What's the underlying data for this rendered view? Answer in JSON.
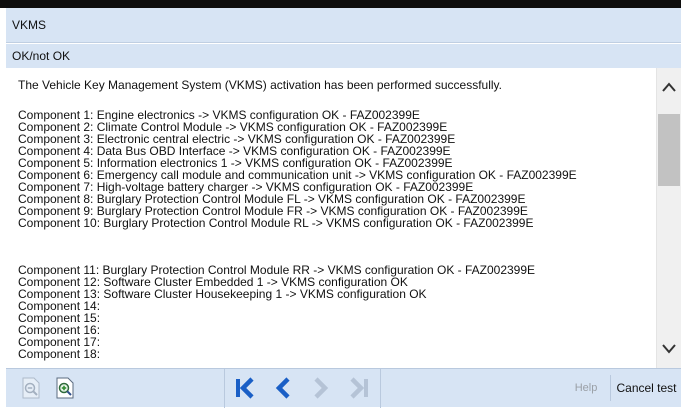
{
  "header": {
    "title": "VKMS",
    "status": "OK/not OK"
  },
  "content": {
    "message": "The Vehicle Key Management System (VKMS) activation has been performed successfully.",
    "group1": [
      "Component 1: Engine electronics -> VKMS configuration OK - FAZ002399E",
      "Component 2: Climate Control Module -> VKMS configuration OK - FAZ002399E",
      "Component 3: Electronic central electric -> VKMS configuration OK - FAZ002399E",
      "Component 4: Data Bus OBD Interface -> VKMS configuration OK - FAZ002399E",
      "Component 5: Information electronics 1 -> VKMS configuration OK - FAZ002399E",
      "Component 6: Emergency call module and communication unit -> VKMS configuration OK - FAZ002399E",
      "Component 7: High-voltage battery charger -> VKMS configuration OK - FAZ002399E",
      "Component 8: Burglary Protection Control Module FL -> VKMS configuration OK - FAZ002399E",
      "Component 9: Burglary Protection Control Module FR -> VKMS configuration OK - FAZ002399E",
      "Component 10: Burglary Protection Control Module RL -> VKMS configuration OK - FAZ002399E"
    ],
    "group2": [
      "Component 11: Burglary Protection Control Module RR -> VKMS configuration OK - FAZ002399E",
      "Component 12: Software Cluster Embedded 1 -> VKMS configuration OK",
      "Component 13: Software Cluster Housekeeping 1 -> VKMS configuration OK",
      "Component 14:",
      "Component 15:",
      "Component 16:",
      "Component 17:",
      "Component 18:"
    ]
  },
  "scrollbar": {
    "position": 0.1
  },
  "footer": {
    "icons": {
      "zoom_out": "zoom-out-icon",
      "zoom_in": "zoom-in-icon",
      "first": "skip-first-icon",
      "prev": "chevron-left-icon",
      "next": "chevron-right-icon",
      "last": "skip-last-icon"
    },
    "help_label": "Help",
    "cancel_label": "Cancel test"
  },
  "colors": {
    "header_bg": "#d7e4f4",
    "nav_active": "#1a5fc6",
    "nav_disabled": "#b5c3d6"
  }
}
